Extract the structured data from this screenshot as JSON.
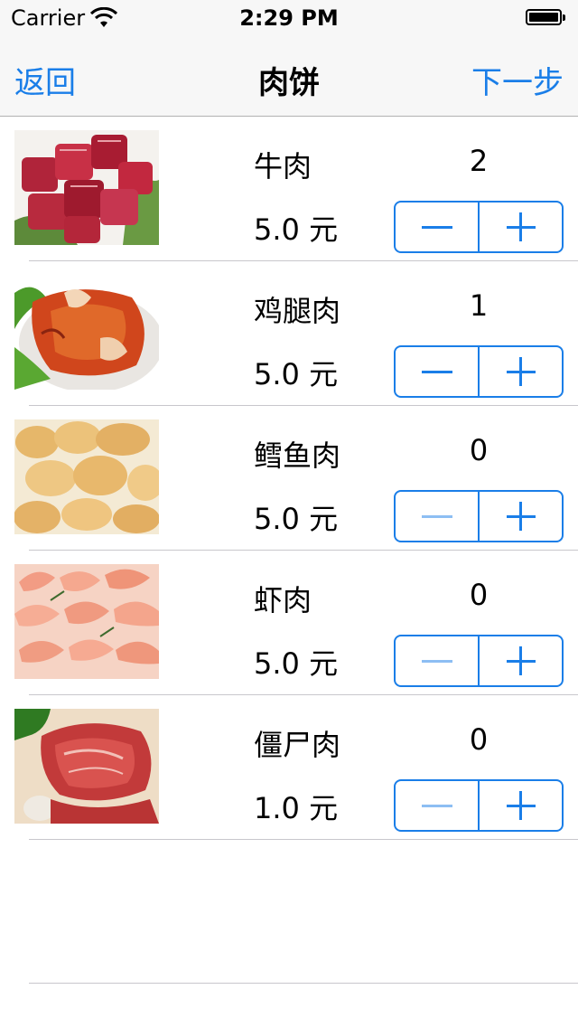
{
  "status_bar": {
    "carrier": "Carrier",
    "time": "2:29 PM"
  },
  "nav": {
    "back_label": "返回",
    "title": "肉饼",
    "next_label": "下一步"
  },
  "items": [
    {
      "name": "牛肉",
      "price": "5.0 元",
      "quantity": "2",
      "minus_enabled": true,
      "image": "beef-cubes"
    },
    {
      "name": "鸡腿肉",
      "price": "5.0 元",
      "quantity": "1",
      "minus_enabled": true,
      "image": "chicken-leg"
    },
    {
      "name": "鳕鱼肉",
      "price": "5.0 元",
      "quantity": "0",
      "minus_enabled": false,
      "image": "fried-cod"
    },
    {
      "name": "虾肉",
      "price": "5.0 元",
      "quantity": "0",
      "minus_enabled": false,
      "image": "shrimp"
    },
    {
      "name": "僵尸肉",
      "price": "1.0 元",
      "quantity": "0",
      "minus_enabled": false,
      "image": "sliced-meat"
    }
  ],
  "colors": {
    "accent": "#1a7ee8",
    "accent_disabled": "#8dbef3",
    "separator": "#c8c7cc"
  }
}
